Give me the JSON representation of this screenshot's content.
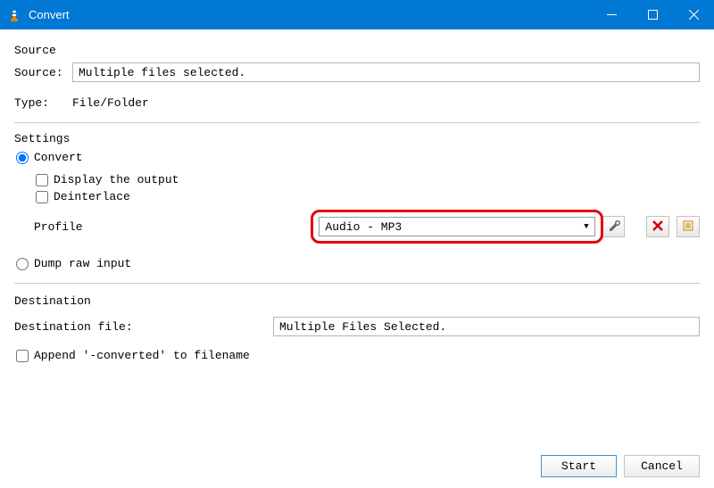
{
  "titlebar": {
    "title": "Convert"
  },
  "source": {
    "section_label": "Source",
    "row_label": "Source:",
    "value": "Multiple files selected.",
    "type_label": "Type:",
    "type_value": "File/Folder"
  },
  "settings": {
    "section_label": "Settings",
    "convert_label": "Convert",
    "display_output_label": "Display the output",
    "deinterlace_label": "Deinterlace",
    "profile_label": "Profile",
    "profile_value": "Audio - MP3",
    "dump_label": "Dump raw input"
  },
  "destination": {
    "section_label": "Destination",
    "file_label": "Destination file:",
    "file_value": "Multiple Files Selected.",
    "append_label": "Append '-converted' to filename"
  },
  "buttons": {
    "start": "Start",
    "cancel": "Cancel"
  }
}
